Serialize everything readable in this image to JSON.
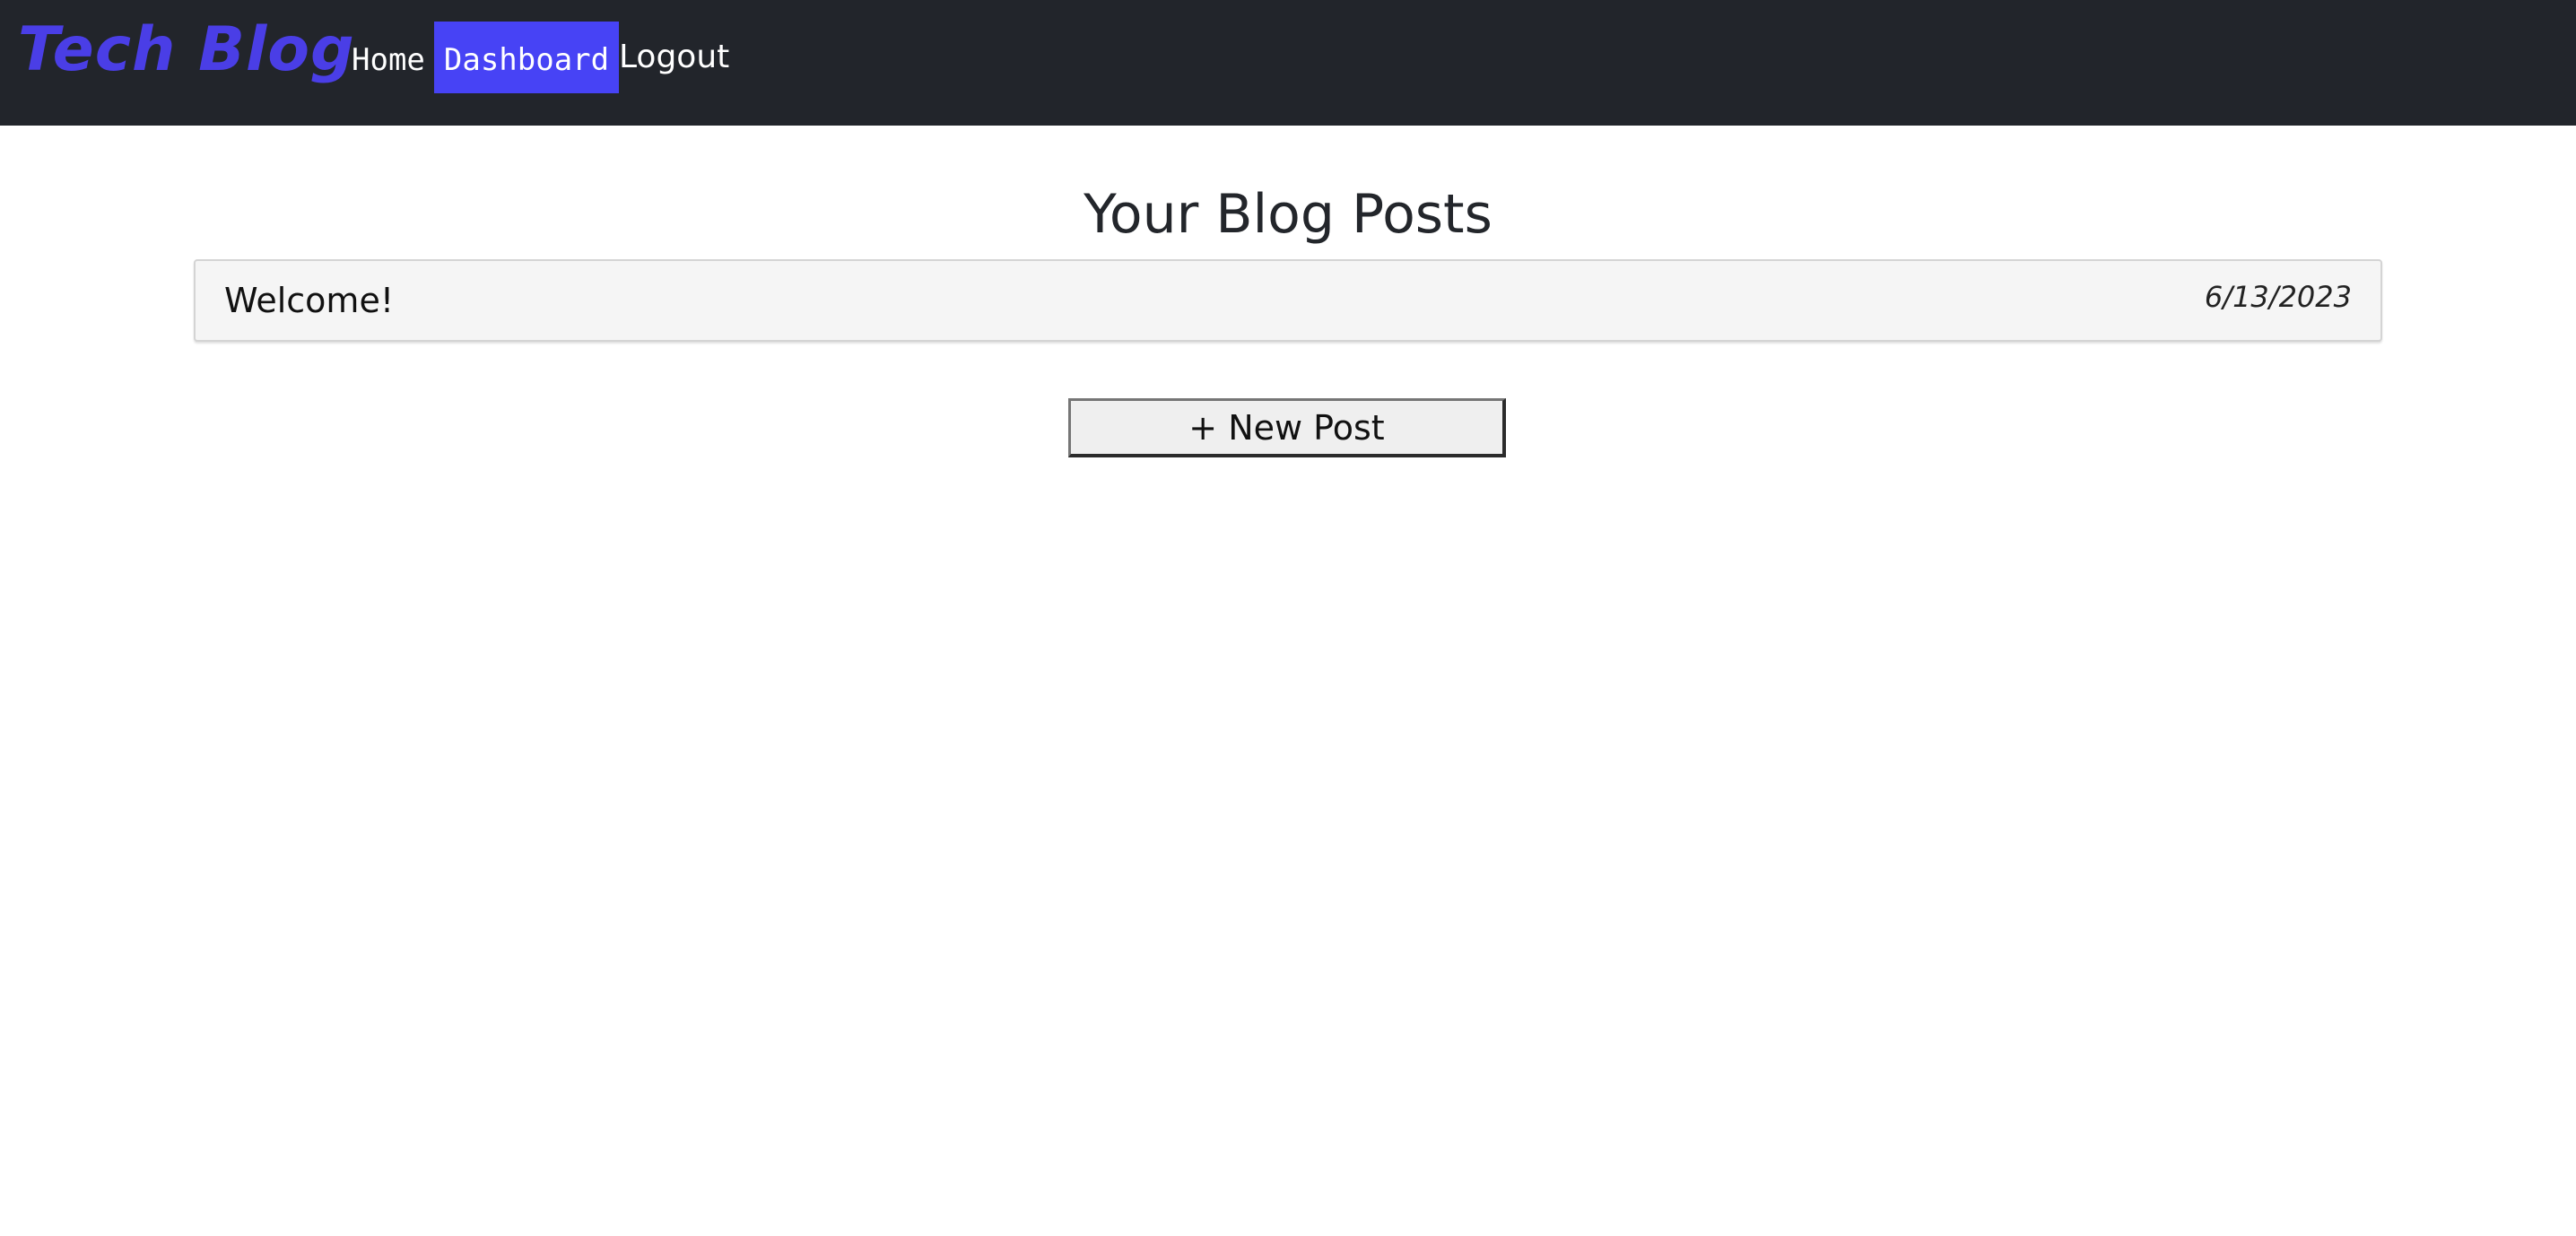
{
  "navbar": {
    "brand": "Tech Blog",
    "links": [
      {
        "label": "Home"
      },
      {
        "label": "Dashboard",
        "active": true
      },
      {
        "label": "Logout"
      }
    ],
    "background_color": "#22252b",
    "brand_color": "#4a3ee6",
    "active_color": "#4743f5"
  },
  "main": {
    "title": "Your Blog Posts",
    "posts": [
      {
        "title": "Welcome!",
        "date": "6/13/2023"
      }
    ],
    "new_post_label": "+ New Post"
  }
}
